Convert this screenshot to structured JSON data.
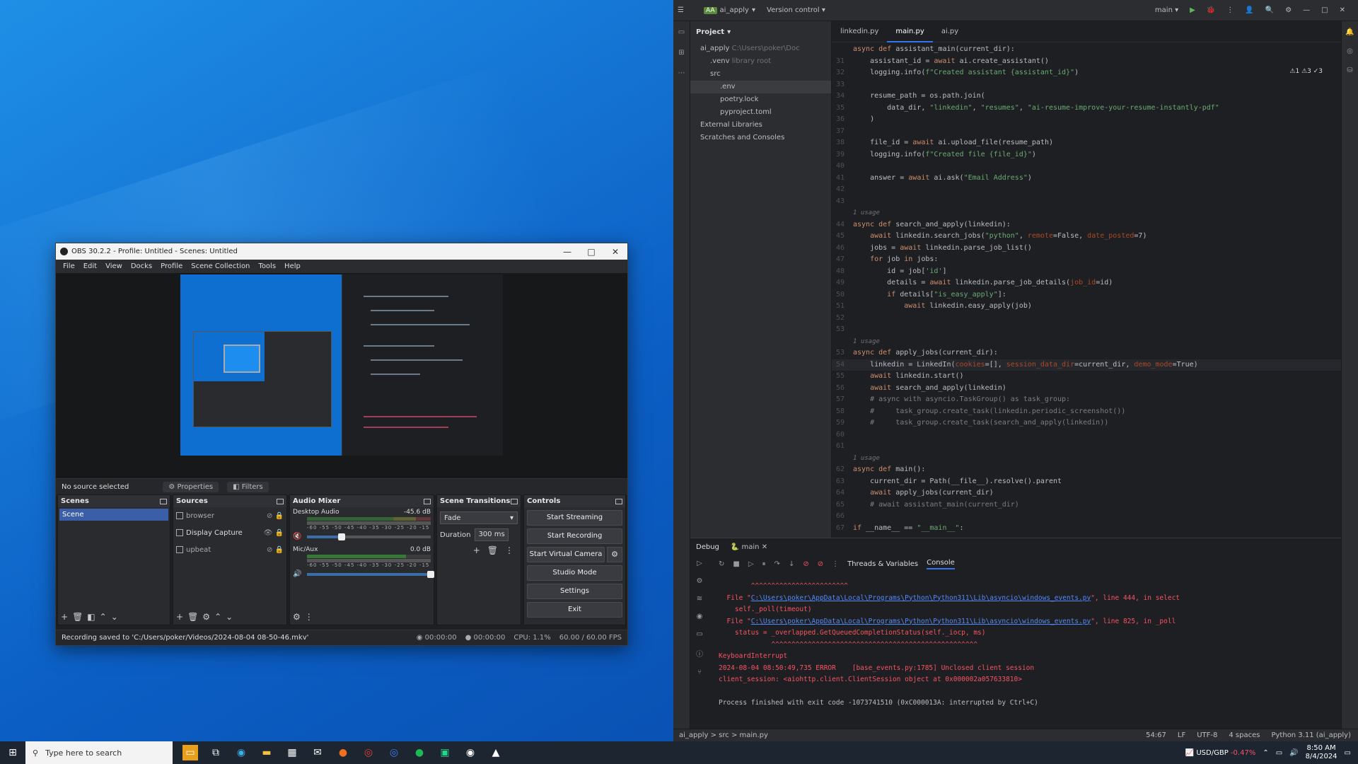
{
  "obs": {
    "title": "OBS 30.2.2 - Profile: Untitled - Scenes: Untitled",
    "menu": [
      "File",
      "Edit",
      "View",
      "Docks",
      "Profile",
      "Scene Collection",
      "Tools",
      "Help"
    ],
    "no_source": "No source selected",
    "properties_label": "Properties",
    "filters_label": "Filters",
    "scenes_title": "Scenes",
    "scenes": [
      "Scene"
    ],
    "sources_title": "Sources",
    "sources": [
      "browser",
      "Display Capture",
      "upbeat"
    ],
    "mixer_title": "Audio Mixer",
    "mixer": [
      {
        "name": "Desktop Audio",
        "db": "-45.6 dB",
        "ticks": "-60 -55 -50 -45 -40 -35 -30 -25 -20 -15 -10 -5 0",
        "volume": 0.28
      },
      {
        "name": "Mic/Aux",
        "db": "0.0 dB",
        "ticks": "-60 -55 -50 -45 -40 -35 -30 -25 -20 -15 -10 -5 0",
        "volume": 1.0
      }
    ],
    "transitions_title": "Scene Transitions",
    "transition": "Fade",
    "duration_label": "Duration",
    "duration": "300 ms",
    "controls_title": "Controls",
    "controls": {
      "start_streaming": "Start Streaming",
      "start_recording": "Start Recording",
      "start_virtual_camera": "Start Virtual Camera",
      "studio_mode": "Studio Mode",
      "settings": "Settings",
      "exit": "Exit"
    },
    "status": {
      "recording_saved": "Recording saved to 'C:/Users/poker/Videos/2024-08-04 08-50-46.mkv'",
      "stream_time": "00:00:00",
      "rec_time": "00:00:00",
      "cpu": "CPU: 1.1%",
      "fps": "60.00 / 60.00 FPS"
    }
  },
  "ide": {
    "project_name": "ai_apply",
    "project_badge": "AA",
    "version_control": "Version control",
    "branch": "main",
    "project_label": "Project",
    "tree": [
      {
        "text": "ai_apply",
        "dim": "C:\\Users\\poker\\Doc",
        "indent": 1
      },
      {
        "text": ".venv",
        "dim": "library root",
        "indent": 2
      },
      {
        "text": "src",
        "dim": "",
        "indent": 2
      },
      {
        "text": ".env",
        "dim": "",
        "indent": 3,
        "sel": true
      },
      {
        "text": "poetry.lock",
        "dim": "",
        "indent": 3
      },
      {
        "text": "pyproject.toml",
        "dim": "",
        "indent": 3
      },
      {
        "text": "External Libraries",
        "dim": "",
        "indent": 1
      },
      {
        "text": "Scratches and Consoles",
        "dim": "",
        "indent": 1
      }
    ],
    "tabs": [
      "linkedin.py",
      "main.py",
      "ai.py"
    ],
    "inspections": "⚠1 ⚠3 ✓3",
    "code": [
      {
        "n": "",
        "t": "async def assistant_main(current_dir):"
      },
      {
        "n": "31",
        "t": "    assistant_id = await ai.create_assistant()"
      },
      {
        "n": "32",
        "t": "    logging.info(f\"Created assistant {assistant_id}\")"
      },
      {
        "n": "33",
        "t": ""
      },
      {
        "n": "34",
        "t": "    resume_path = os.path.join("
      },
      {
        "n": "35",
        "t": "        data_dir, \"linkedin\", \"resumes\", \"ai-resume-improve-your-resume-instantly-pdf\""
      },
      {
        "n": "36",
        "t": "    )"
      },
      {
        "n": "37",
        "t": ""
      },
      {
        "n": "38",
        "t": "    file_id = await ai.upload_file(resume_path)"
      },
      {
        "n": "39",
        "t": "    logging.info(f\"Created file {file_id}\")"
      },
      {
        "n": "40",
        "t": ""
      },
      {
        "n": "41",
        "t": "    answer = await ai.ask(\"Email Address\")"
      },
      {
        "n": "42",
        "t": ""
      },
      {
        "n": "43",
        "t": ""
      },
      {
        "n": "",
        "t": "1 usage",
        "usage": true
      },
      {
        "n": "44",
        "t": "async def search_and_apply(linkedin):"
      },
      {
        "n": "45",
        "t": "    await linkedin.search_jobs(\"python\", remote=False, date_posted=7)"
      },
      {
        "n": "46",
        "t": "    jobs = await linkedin.parse_job_list()"
      },
      {
        "n": "47",
        "t": "    for job in jobs:"
      },
      {
        "n": "48",
        "t": "        id = job['id']"
      },
      {
        "n": "49",
        "t": "        details = await linkedin.parse_job_details(job_id=id)"
      },
      {
        "n": "50",
        "t": "        if details[\"is_easy_apply\"]:"
      },
      {
        "n": "51",
        "t": "            await linkedin.easy_apply(job)"
      },
      {
        "n": "52",
        "t": ""
      },
      {
        "n": "53",
        "t": ""
      },
      {
        "n": "",
        "t": "1 usage",
        "usage": true
      },
      {
        "n": "53",
        "t": "async def apply_jobs(current_dir):"
      },
      {
        "n": "54",
        "t": "    linkedin = LinkedIn(cookies=[], session_data_dir=current_dir, demo_mode=True)",
        "cur": true
      },
      {
        "n": "55",
        "t": "    await linkedin.start()"
      },
      {
        "n": "56",
        "t": "    await search_and_apply(linkedin)"
      },
      {
        "n": "57",
        "t": "    # async with asyncio.TaskGroup() as task_group:"
      },
      {
        "n": "58",
        "t": "    #     task_group.create_task(linkedin.periodic_screenshot())"
      },
      {
        "n": "59",
        "t": "    #     task_group.create_task(search_and_apply(linkedin))"
      },
      {
        "n": "60",
        "t": ""
      },
      {
        "n": "61",
        "t": ""
      },
      {
        "n": "",
        "t": "1 usage",
        "usage": true
      },
      {
        "n": "62",
        "t": "async def main():"
      },
      {
        "n": "63",
        "t": "    current_dir = Path(__file__).resolve().parent"
      },
      {
        "n": "64",
        "t": "    await apply_jobs(current_dir)"
      },
      {
        "n": "65",
        "t": "    # await assistant_main(current_dir)"
      },
      {
        "n": "66",
        "t": ""
      },
      {
        "n": "67",
        "t": "if __name__ == \"__main__\":"
      }
    ],
    "debug_label": "Debug",
    "run_config": "main",
    "threads_tab": "Threads & Variables",
    "console_tab": "Console",
    "console": [
      {
        "t": "        ^^^^^^^^^^^^^^^^^^^^^^^^",
        "c": ""
      },
      {
        "t": "  File \"C:\\Users\\poker\\AppData\\Local\\Programs\\Python\\Python311\\Lib\\asyncio\\windows_events.py\", line 444, in select",
        "c": ""
      },
      {
        "t": "    self._poll(timeout)",
        "c": ""
      },
      {
        "t": "  File \"C:\\Users\\poker\\AppData\\Local\\Programs\\Python\\Python311\\Lib\\asyncio\\windows_events.py\", line 825, in _poll",
        "c": ""
      },
      {
        "t": "    status = _overlapped.GetQueuedCompletionStatus(self._iocp, ms)",
        "c": ""
      },
      {
        "t": "             ^^^^^^^^^^^^^^^^^^^^^^^^^^^^^^^^^^^^^^^^^^^^^^^^^^^",
        "c": ""
      },
      {
        "t": "KeyboardInterrupt",
        "c": ""
      },
      {
        "t": "2024-08-04 08:50:49,735 ERROR    [base_events.py:1785] Unclosed client session",
        "c": ""
      },
      {
        "t": "client_session: <aiohttp.client.ClientSession object at 0x000002a057633810>",
        "c": ""
      },
      {
        "t": "",
        "c": ""
      },
      {
        "t": "Process finished with exit code -1073741510 (0xC000013A: interrupted by Ctrl+C)",
        "c": "ok"
      }
    ],
    "status": {
      "crumbs": "ai_apply  >  src  >  main.py",
      "pos": "54:67",
      "le": "LF",
      "enc": "UTF-8",
      "indent": "4 spaces",
      "interp": "Python 3.11 (ai_apply)"
    }
  },
  "taskbar": {
    "search_placeholder": "Type here to search",
    "currency": "USD/GBP",
    "change": "-0.47%",
    "time": "8:50 AM",
    "date": "8/4/2024"
  }
}
